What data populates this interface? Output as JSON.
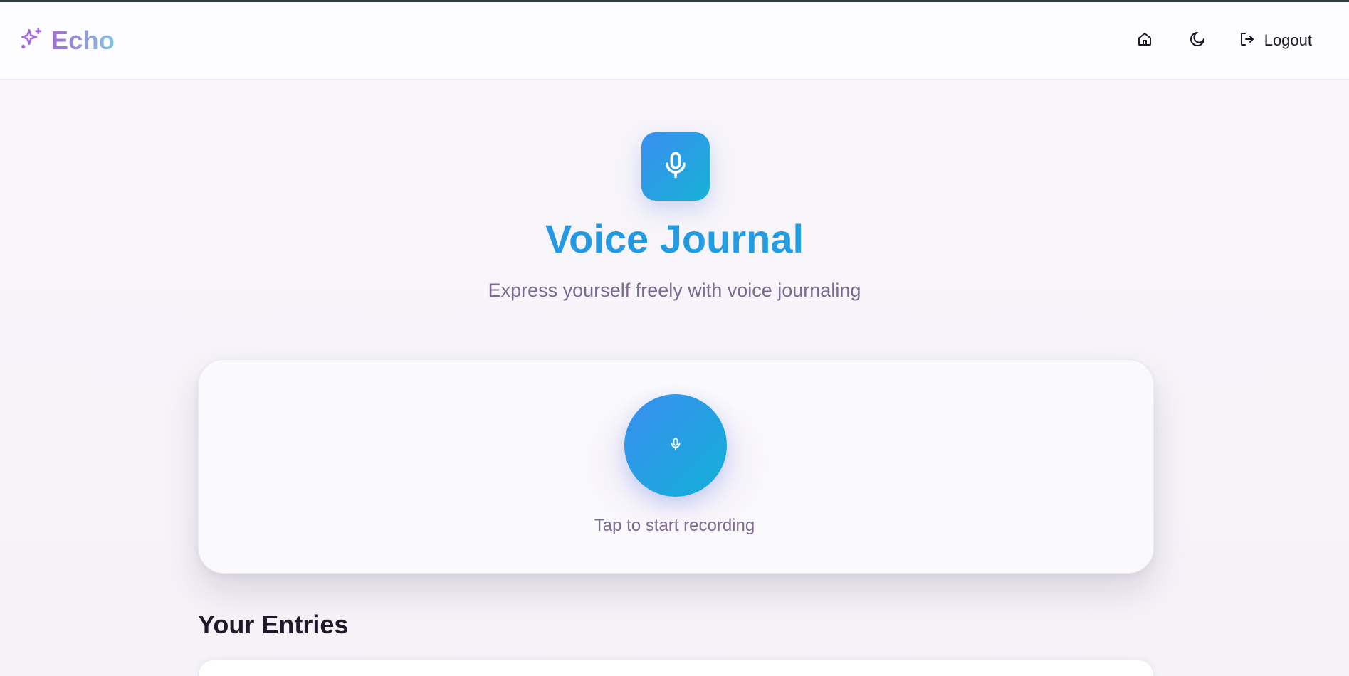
{
  "header": {
    "brand_name": "Echo",
    "brand_icon": "sparkles-icon",
    "nav": {
      "home_icon": "home-icon",
      "theme_icon": "moon-icon",
      "logout_icon": "logout-icon",
      "logout_label": "Logout"
    }
  },
  "hero": {
    "icon": "microphone-icon",
    "title": "Voice Journal",
    "subtitle": "Express yourself freely with voice journaling"
  },
  "recorder": {
    "icon": "microphone-icon",
    "hint": "Tap to start recording"
  },
  "entries": {
    "title": "Your Entries"
  },
  "colors": {
    "brand_gradient_start": "#a36bd6",
    "brand_gradient_end": "#7fc7dc",
    "accent_blue": "#3a8ef0",
    "accent_cyan": "#12b0d8",
    "muted_text": "#7d6a93"
  }
}
